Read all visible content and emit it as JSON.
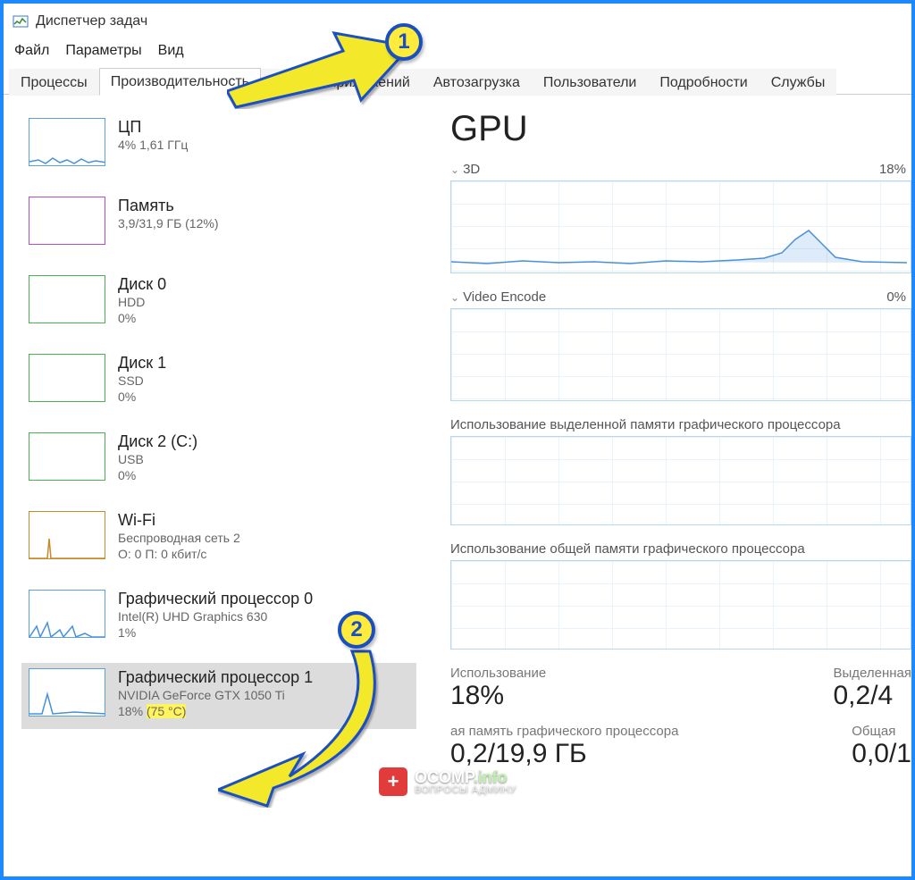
{
  "window": {
    "title": "Диспетчер задач"
  },
  "menu": {
    "file": "Файл",
    "options": "Параметры",
    "view": "Вид"
  },
  "tabs": [
    {
      "label": "Процессы"
    },
    {
      "label": "Производительность"
    },
    {
      "label": "Журнал приложений"
    },
    {
      "label": "Автозагрузка"
    },
    {
      "label": "Пользователи"
    },
    {
      "label": "Подробности"
    },
    {
      "label": "Службы"
    }
  ],
  "active_tab_index": 1,
  "sidebar": [
    {
      "label": "ЦП",
      "sub": "4% 1,61 ГГц",
      "kind": "cpu"
    },
    {
      "label": "Память",
      "sub": "3,9/31,9 ГБ (12%)",
      "kind": "mem"
    },
    {
      "label": "Диск 0",
      "sub": "HDD",
      "sub2": "0%",
      "kind": "disk"
    },
    {
      "label": "Диск 1",
      "sub": "SSD",
      "sub2": "0%",
      "kind": "disk"
    },
    {
      "label": "Диск 2 (C:)",
      "sub": "USB",
      "sub2": "0%",
      "kind": "disk"
    },
    {
      "label": "Wi-Fi",
      "sub": "Беспроводная сеть 2",
      "sub2": "О: 0 П: 0 кбит/с",
      "kind": "wifi"
    },
    {
      "label": "Графический процессор 0",
      "sub": "Intel(R) UHD Graphics 630",
      "sub2": "1%",
      "kind": "gpu"
    },
    {
      "label": "Графический процессор 1",
      "sub": "NVIDIA GeForce GTX 1050 Ti",
      "sub2_prefix": "18% ",
      "sub2_temp": "(75 °C)",
      "kind": "gpu"
    }
  ],
  "selected_sidebar_index": 7,
  "main": {
    "title": "GPU",
    "charts": [
      {
        "label": "3D",
        "percent": "18%"
      },
      {
        "label": "Video Encode",
        "percent": "0%"
      }
    ],
    "mem_charts": [
      {
        "label": "Использование выделенной памяти графического процессора"
      },
      {
        "label": "Использование общей памяти графического процессора"
      }
    ],
    "stats": {
      "usage_label": "Использование",
      "usage_value": "18%",
      "dedicated_label": "Выделенная",
      "dedicated_value": "0,2/4",
      "shared_label": "ая память графического процессора",
      "shared_value": "0,2/19,9 ГБ",
      "total_label": "Общая",
      "total_value": "0,0/1"
    }
  },
  "callouts": {
    "one": "1",
    "two": "2"
  },
  "watermark": {
    "plus": "+",
    "brand_main": "OCOMP",
    "brand_suffix": ".info",
    "tagline": "ВОПРОСЫ АДМИНУ"
  },
  "chart_data": {
    "type": "line",
    "title": "3D",
    "ylim": [
      0,
      100
    ],
    "x": [
      0,
      1,
      2,
      3,
      4,
      5,
      6,
      7,
      8,
      9,
      10,
      11,
      12,
      13,
      14,
      15,
      16,
      17,
      18,
      19,
      20,
      21,
      22,
      23,
      24,
      25,
      26,
      27,
      28,
      29
    ],
    "values": [
      12,
      10,
      12,
      14,
      12,
      11,
      13,
      12,
      11,
      13,
      12,
      14,
      12,
      13,
      12,
      14,
      13,
      12,
      14,
      16,
      20,
      30,
      42,
      36,
      22,
      16,
      14,
      13,
      12,
      12
    ],
    "current": 18
  }
}
